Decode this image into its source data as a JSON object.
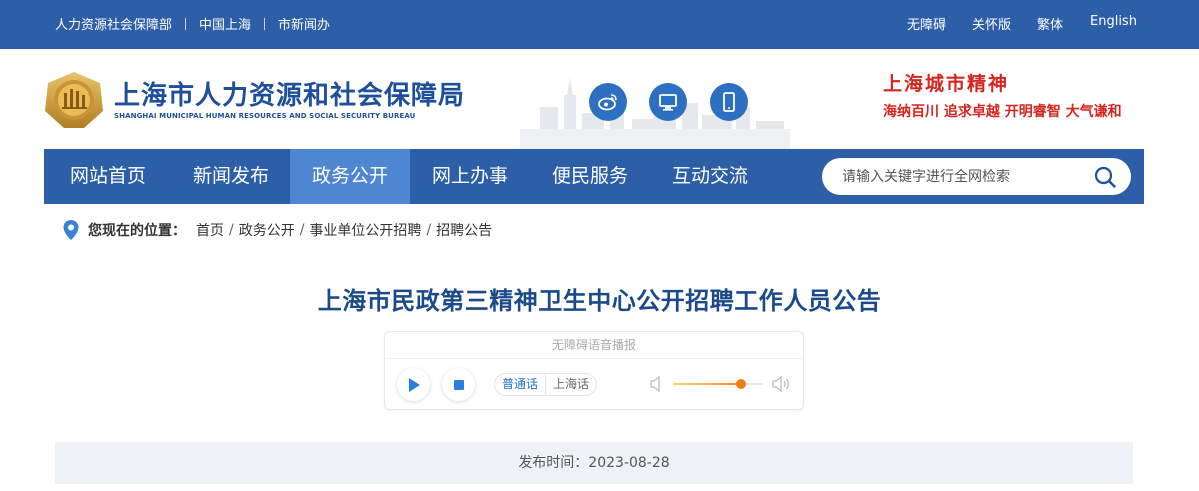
{
  "topbar": {
    "links": [
      "人力资源社会保障部",
      "中国上海",
      "市新闻办"
    ],
    "right": [
      "无障碍",
      "关怀版",
      "繁体",
      "English"
    ]
  },
  "header": {
    "org_name": "上海市人力资源和社会保障局",
    "org_name_en": "SHANGHAI MUNICIPAL HUMAN RESOURCES AND SOCIAL SECURITY BUREAU",
    "social_icons": [
      "weibo-icon",
      "desktop-icon",
      "mobile-icon"
    ],
    "slogan_title": "上海城市精神",
    "slogan_words": "海纳百川  追求卓越  开明睿智  大气谦和"
  },
  "nav": {
    "items": [
      "网站首页",
      "新闻发布",
      "政务公开",
      "网上办事",
      "便民服务",
      "互动交流"
    ],
    "active": "政务公开",
    "search_placeholder": "请输入关键字进行全网检索"
  },
  "breadcrumb": {
    "label": "您现在的位置：",
    "items": [
      "首页",
      "政务公开",
      "事业单位公开招聘",
      "招聘公告"
    ]
  },
  "article": {
    "title": "上海市民政第三精神卫生中心公开招聘工作人员公告",
    "publish": "发布时间：2023-08-28"
  },
  "player": {
    "title": "无障碍语音播报",
    "lang_on": "普通话",
    "lang_off": "上海话",
    "volume": 0.75
  },
  "colors": {
    "primary": "#2d5ea8",
    "nav_active": "#4e86d2",
    "title": "#1b4a8a",
    "slogan": "#d4261f"
  }
}
